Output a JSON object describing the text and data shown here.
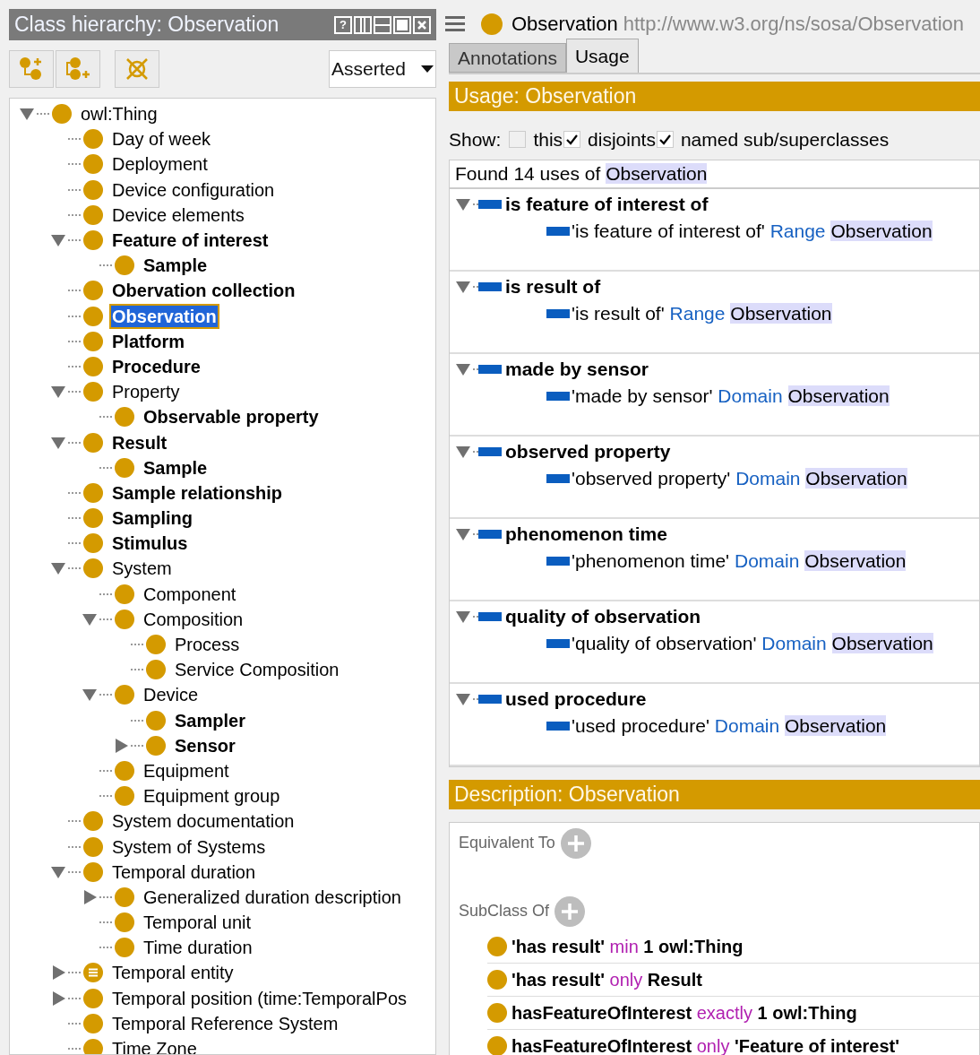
{
  "hierarchy_panel": {
    "title": "Class hierarchy: Observation",
    "help_button": "?",
    "view_select": {
      "value": "Asserted"
    },
    "tree": [
      {
        "label": "owl:Thing",
        "kind": "class",
        "bold": false,
        "selected": false,
        "expanded": true,
        "children": [
          {
            "label": "Day of week",
            "kind": "class",
            "bold": false,
            "selected": false
          },
          {
            "label": "Deployment",
            "kind": "class",
            "bold": false,
            "selected": false
          },
          {
            "label": "Device configuration",
            "kind": "class",
            "bold": false,
            "selected": false
          },
          {
            "label": "Device elements",
            "kind": "class",
            "bold": false,
            "selected": false
          },
          {
            "label": "Feature of interest",
            "kind": "class",
            "bold": true,
            "selected": false,
            "expanded": true,
            "children": [
              {
                "label": "Sample",
                "kind": "class",
                "bold": true,
                "selected": false
              }
            ]
          },
          {
            "label": "Obervation collection",
            "kind": "class",
            "bold": true,
            "selected": false
          },
          {
            "label": "Observation",
            "kind": "class",
            "bold": true,
            "selected": true
          },
          {
            "label": "Platform",
            "kind": "class",
            "bold": true,
            "selected": false
          },
          {
            "label": "Procedure",
            "kind": "class",
            "bold": true,
            "selected": false
          },
          {
            "label": "Property",
            "kind": "class",
            "bold": false,
            "selected": false,
            "expanded": true,
            "children": [
              {
                "label": "Observable property",
                "kind": "class",
                "bold": true,
                "selected": false
              }
            ]
          },
          {
            "label": "Result",
            "kind": "class",
            "bold": true,
            "selected": false,
            "expanded": true,
            "children": [
              {
                "label": "Sample",
                "kind": "class",
                "bold": true,
                "selected": false
              }
            ]
          },
          {
            "label": "Sample relationship",
            "kind": "class",
            "bold": true,
            "selected": false
          },
          {
            "label": "Sampling",
            "kind": "class",
            "bold": true,
            "selected": false
          },
          {
            "label": "Stimulus",
            "kind": "class",
            "bold": true,
            "selected": false
          },
          {
            "label": "System",
            "kind": "class",
            "bold": false,
            "selected": false,
            "expanded": true,
            "children": [
              {
                "label": "Component",
                "kind": "class",
                "bold": false,
                "selected": false
              },
              {
                "label": "Composition",
                "kind": "class",
                "bold": false,
                "selected": false,
                "expanded": true,
                "children": [
                  {
                    "label": "Process",
                    "kind": "class",
                    "bold": false,
                    "selected": false
                  },
                  {
                    "label": "Service Composition",
                    "kind": "class",
                    "bold": false,
                    "selected": false
                  }
                ]
              },
              {
                "label": "Device",
                "kind": "class",
                "bold": false,
                "selected": false,
                "expanded": true,
                "children": [
                  {
                    "label": "Sampler",
                    "kind": "class",
                    "bold": true,
                    "selected": false
                  },
                  {
                    "label": "Sensor",
                    "kind": "class",
                    "bold": true,
                    "selected": false,
                    "expanded": false
                  }
                ]
              },
              {
                "label": "Equipment",
                "kind": "class",
                "bold": false,
                "selected": false
              },
              {
                "label": "Equipment group",
                "kind": "class",
                "bold": false,
                "selected": false
              }
            ]
          },
          {
            "label": "System documentation",
            "kind": "class",
            "bold": false,
            "selected": false
          },
          {
            "label": "System of Systems",
            "kind": "class",
            "bold": false,
            "selected": false
          },
          {
            "label": "Temporal duration",
            "kind": "class",
            "bold": false,
            "selected": false,
            "expanded": true,
            "children": [
              {
                "label": "Generalized duration description",
                "kind": "class",
                "bold": false,
                "selected": false,
                "expanded": false
              },
              {
                "label": "Temporal unit",
                "kind": "class",
                "bold": false,
                "selected": false
              },
              {
                "label": "Time duration",
                "kind": "class",
                "bold": false,
                "selected": false
              }
            ]
          },
          {
            "label": "Temporal entity",
            "kind": "defined",
            "bold": false,
            "selected": false,
            "expanded": false
          },
          {
            "label": "Temporal position (time:TemporalPos",
            "kind": "class",
            "bold": false,
            "selected": false,
            "expanded": false
          },
          {
            "label": "Temporal Reference System",
            "kind": "class",
            "bold": false,
            "selected": false
          },
          {
            "label": "Time Zone",
            "kind": "class",
            "bold": false,
            "selected": false
          }
        ]
      }
    ]
  },
  "entity_header": {
    "name": "Observation",
    "iri": "http://www.w3.org/ns/sosa/Observation"
  },
  "tabs": [
    {
      "label": "Annotations",
      "selected": false
    },
    {
      "label": "Usage",
      "selected": true
    }
  ],
  "usage": {
    "title": "Usage: Observation",
    "show_label": "Show:",
    "filters": [
      {
        "label": "this",
        "checked": false
      },
      {
        "label": "disjoints",
        "checked": true
      },
      {
        "label": "named sub/superclasses",
        "checked": true
      }
    ],
    "found_text": "Found 14 uses of",
    "found_entity": "Observation",
    "groups": [
      {
        "header": "is feature of interest of",
        "expanded": true,
        "item": {
          "property": "'is feature of interest of'",
          "relation": "Range",
          "target": "Observation"
        }
      },
      {
        "header": "is result of",
        "expanded": true,
        "item": {
          "property": "'is result of'",
          "relation": "Range",
          "target": "Observation"
        }
      },
      {
        "header": "made by sensor",
        "expanded": true,
        "item": {
          "property": "'made by sensor'",
          "relation": "Domain",
          "target": "Observation"
        }
      },
      {
        "header": "observed property",
        "expanded": true,
        "item": {
          "property": "'observed property'",
          "relation": "Domain",
          "target": "Observation"
        }
      },
      {
        "header": "phenomenon time",
        "expanded": true,
        "item": {
          "property": "'phenomenon time'",
          "relation": "Domain",
          "target": "Observation"
        }
      },
      {
        "header": "quality of observation",
        "expanded": true,
        "item": {
          "property": "'quality of observation'",
          "relation": "Domain",
          "target": "Observation"
        }
      },
      {
        "header": "used procedure",
        "expanded": true,
        "item": {
          "property": "'used procedure'",
          "relation": "Domain",
          "target": "Observation"
        }
      }
    ]
  },
  "description": {
    "title": "Description: Observation",
    "sections": [
      {
        "label": "Equivalent To"
      },
      {
        "label": "SubClass Of",
        "items": [
          [
            {
              "kind": "term",
              "text": "'has result'"
            },
            {
              "kind": "keyword",
              "text": "min"
            },
            {
              "kind": "term",
              "text": "1 owl:Thing"
            }
          ],
          [
            {
              "kind": "term",
              "text": "'has result'"
            },
            {
              "kind": "keyword",
              "text": "only"
            },
            {
              "kind": "term",
              "text": "Result"
            }
          ],
          [
            {
              "kind": "term",
              "text": "hasFeatureOfInterest"
            },
            {
              "kind": "keyword",
              "text": "exactly"
            },
            {
              "kind": "term",
              "text": "1 owl:Thing"
            }
          ],
          [
            {
              "kind": "term",
              "text": "hasFeatureOfInterest"
            },
            {
              "kind": "keyword",
              "text": "only"
            },
            {
              "kind": "term",
              "text": "'Feature of interest'"
            }
          ]
        ]
      }
    ]
  }
}
